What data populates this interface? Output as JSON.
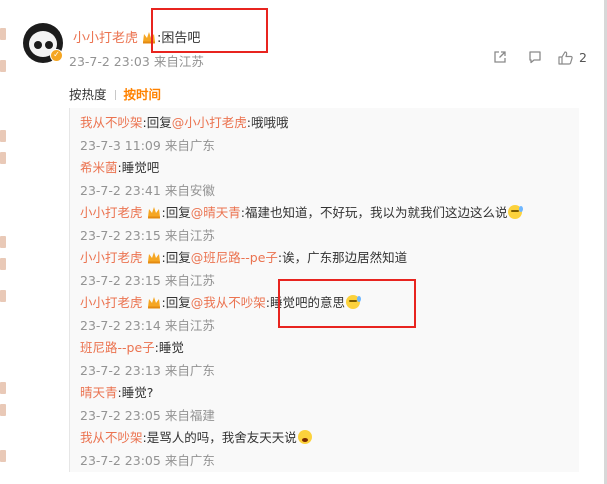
{
  "top_comment": {
    "user": "小小打老虎",
    "text": ":困告吧",
    "date": "23-7-2 23:03",
    "location": "来自江苏",
    "like_count": "2"
  },
  "sort": {
    "hot_label": "按热度",
    "time_label": "按时间"
  },
  "replies": [
    {
      "user": "我从不吵架",
      "pre": ":回复",
      "mention": "@小小打老虎",
      "text": ":哦哦哦",
      "date": "23-7-3 11:09",
      "location": "来自广东"
    },
    {
      "user": "希米菌",
      "pre": "",
      "mention": "",
      "text": ":睡觉吧",
      "date": "23-7-2 23:41",
      "location": "来自安徽"
    },
    {
      "user": "小小打老虎",
      "pre": ":回复",
      "mention": "@晴天青",
      "text": ":福建也知道，不好玩，我以为就我们这边这么说",
      "date": "23-7-2 23:15",
      "location": "来自江苏"
    },
    {
      "user": "小小打老虎",
      "pre": ":回复",
      "mention": "@班尼路--pe子",
      "text": ":诶，广东那边居然知道",
      "date": "23-7-2 23:15",
      "location": "来自江苏"
    },
    {
      "user": "小小打老虎",
      "pre": ":回复",
      "mention": "@我从不吵架",
      "text": ":睡觉吧的意思",
      "date": "23-7-2 23:14",
      "location": "来自江苏"
    },
    {
      "user": "班尼路--pe子",
      "pre": "",
      "mention": "",
      "text": ":睡觉",
      "date": "23-7-2 23:13",
      "location": "来自广东"
    },
    {
      "user": "晴天青",
      "pre": "",
      "mention": "",
      "text": ":睡觉?",
      "date": "23-7-2 23:05",
      "location": "来自福建"
    },
    {
      "user": "我从不吵架",
      "pre": "",
      "mention": "",
      "text": ":是骂人的吗，我舍友天天说",
      "date": "23-7-2 23:05",
      "location": "来自广东"
    }
  ],
  "colors": {
    "name": "#eb7350",
    "accent": "#ff8200",
    "highlight_box": "#e8241f"
  }
}
